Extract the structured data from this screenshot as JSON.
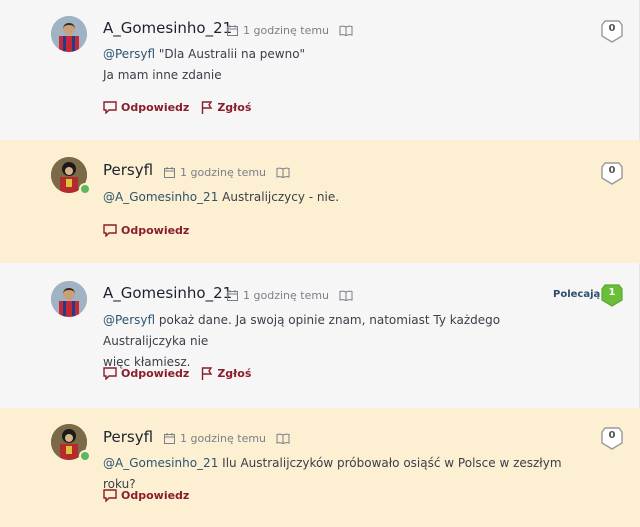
{
  "comments": [
    {
      "author": "A_Gomesinho_21",
      "time": "1 godzinę temu",
      "mention": "@Persyfl",
      "lines": [
        "\"Dla Australii na pewno\"",
        "Ja mam inne zdanie"
      ],
      "reply_label": "Odpowiedz",
      "report_label": "Zgłoś",
      "votes": "0"
    },
    {
      "author": "Persyfl",
      "time": "1 godzinę temu",
      "mention": "@A_Gomesinho_21",
      "lines": [
        "Australijczycy - nie."
      ],
      "reply_label": "Odpowiedz",
      "votes": "0"
    },
    {
      "author": "A_Gomesinho_21",
      "time": "1 godzinę temu",
      "mention": "@Persyfl",
      "lines": [
        "pokaż dane. Ja swoją opinie znam, natomiast Ty każdego Australijczyka nie",
        "więc kłamiesz."
      ],
      "reply_label": "Odpowiedz",
      "report_label": "Zgłoś",
      "recommend_label": "Polecają",
      "votes": "1"
    },
    {
      "author": "Persyfl",
      "time": "1 godzinę temu",
      "mention": "@A_Gomesinho_21",
      "lines": [
        "Ilu Australijczyków próbowało osiąść w Polsce w zeszłym roku?"
      ],
      "reply_label": "Odpowiedz",
      "votes": "0"
    }
  ],
  "colors": {
    "accent": "#8a1d2c",
    "mention": "#2c5470",
    "cream_bg": "#fcefd2",
    "white_bg": "#f6f6f6",
    "recommended": "#6abf3a",
    "online": "#5cb85c"
  },
  "icons": {
    "calendar": "calendar-icon",
    "book": "book-icon",
    "reply": "reply-icon",
    "report": "flag-icon",
    "vote": "shield-icon"
  }
}
